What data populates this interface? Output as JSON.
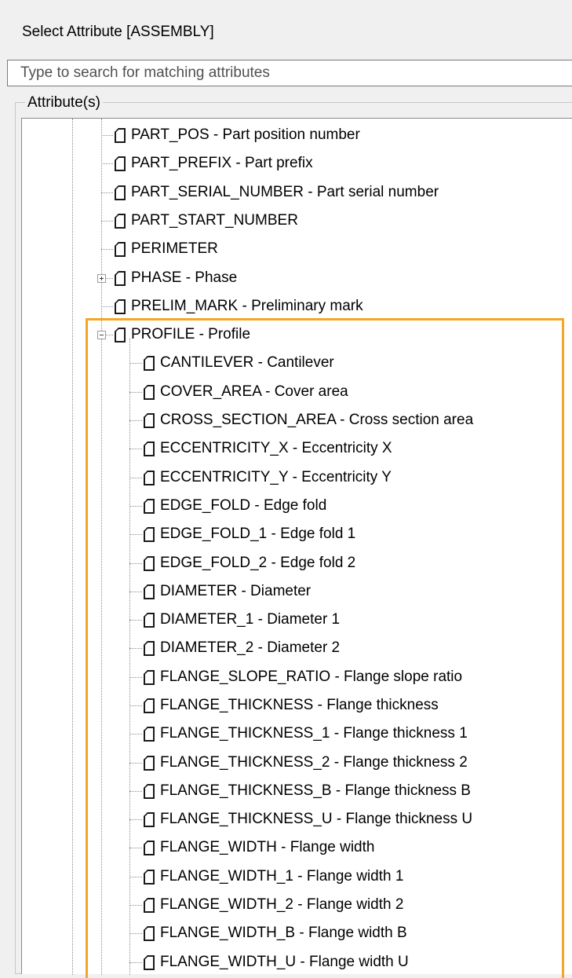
{
  "dialog": {
    "title": "Select Attribute [ASSEMBLY]"
  },
  "search": {
    "placeholder": "Type to search for matching attributes",
    "value": ""
  },
  "attributes_group": {
    "label": "Attribute(s)"
  },
  "colors": {
    "highlight": "#f5a623"
  },
  "tree": {
    "items": [
      {
        "name": "PART_POS",
        "description": "Part position number",
        "text": "PART_POS  -  Part position number",
        "level": 1
      },
      {
        "name": "PART_PREFIX",
        "description": "Part prefix",
        "text": "PART_PREFIX  -  Part prefix",
        "level": 1
      },
      {
        "name": "PART_SERIAL_NUMBER",
        "description": "Part serial number",
        "text": "PART_SERIAL_NUMBER  -  Part serial number",
        "level": 1
      },
      {
        "name": "PART_START_NUMBER",
        "description": "",
        "text": "PART_START_NUMBER",
        "level": 1
      },
      {
        "name": "PERIMETER",
        "description": "",
        "text": "PERIMETER",
        "level": 1
      },
      {
        "name": "PHASE",
        "description": "Phase",
        "text": "PHASE  -  Phase",
        "level": 1,
        "expander": "collapsed"
      },
      {
        "name": "PRELIM_MARK",
        "description": "Preliminary mark",
        "text": "PRELIM_MARK  -  Preliminary mark",
        "level": 1
      },
      {
        "name": "PROFILE",
        "description": "Profile",
        "text": "PROFILE  -  Profile",
        "level": 1,
        "expander": "expanded"
      },
      {
        "name": "CANTILEVER",
        "description": "Cantilever",
        "text": "CANTILEVER  -  Cantilever",
        "level": 2
      },
      {
        "name": "COVER_AREA",
        "description": "Cover area",
        "text": "COVER_AREA  -  Cover area",
        "level": 2
      },
      {
        "name": "CROSS_SECTION_AREA",
        "description": "Cross section area",
        "text": "CROSS_SECTION_AREA  -  Cross section area",
        "level": 2
      },
      {
        "name": "ECCENTRICITY_X",
        "description": "Eccentricity X",
        "text": "ECCENTRICITY_X  -  Eccentricity X",
        "level": 2
      },
      {
        "name": "ECCENTRICITY_Y",
        "description": "Eccentricity Y",
        "text": "ECCENTRICITY_Y  -  Eccentricity Y",
        "level": 2
      },
      {
        "name": "EDGE_FOLD",
        "description": "Edge fold",
        "text": "EDGE_FOLD  -  Edge fold",
        "level": 2
      },
      {
        "name": "EDGE_FOLD_1",
        "description": "Edge fold 1",
        "text": "EDGE_FOLD_1  -  Edge fold 1",
        "level": 2
      },
      {
        "name": "EDGE_FOLD_2",
        "description": "Edge fold 2",
        "text": "EDGE_FOLD_2  -  Edge fold 2",
        "level": 2
      },
      {
        "name": "DIAMETER",
        "description": "Diameter",
        "text": "DIAMETER  -  Diameter",
        "level": 2
      },
      {
        "name": "DIAMETER_1",
        "description": "Diameter 1",
        "text": "DIAMETER_1  -  Diameter 1",
        "level": 2
      },
      {
        "name": "DIAMETER_2",
        "description": "Diameter 2",
        "text": "DIAMETER_2  -  Diameter 2",
        "level": 2
      },
      {
        "name": "FLANGE_SLOPE_RATIO",
        "description": "Flange slope ratio",
        "text": "FLANGE_SLOPE_RATIO  -  Flange slope ratio",
        "level": 2
      },
      {
        "name": "FLANGE_THICKNESS",
        "description": "Flange thickness",
        "text": "FLANGE_THICKNESS  -  Flange thickness",
        "level": 2
      },
      {
        "name": "FLANGE_THICKNESS_1",
        "description": "Flange thickness 1",
        "text": "FLANGE_THICKNESS_1  -  Flange thickness 1",
        "level": 2
      },
      {
        "name": "FLANGE_THICKNESS_2",
        "description": "Flange thickness 2",
        "text": "FLANGE_THICKNESS_2  -  Flange thickness 2",
        "level": 2
      },
      {
        "name": "FLANGE_THICKNESS_B",
        "description": "Flange thickness B",
        "text": "FLANGE_THICKNESS_B  -  Flange thickness B",
        "level": 2
      },
      {
        "name": "FLANGE_THICKNESS_U",
        "description": "Flange thickness U",
        "text": "FLANGE_THICKNESS_U  -  Flange thickness U",
        "level": 2
      },
      {
        "name": "FLANGE_WIDTH",
        "description": "Flange width",
        "text": "FLANGE_WIDTH  -  Flange width",
        "level": 2
      },
      {
        "name": "FLANGE_WIDTH_1",
        "description": "Flange width 1",
        "text": "FLANGE_WIDTH_1  -  Flange width 1",
        "level": 2
      },
      {
        "name": "FLANGE_WIDTH_2",
        "description": "Flange width 2",
        "text": "FLANGE_WIDTH_2  -  Flange width 2",
        "level": 2
      },
      {
        "name": "FLANGE_WIDTH_B",
        "description": "Flange width B",
        "text": "FLANGE_WIDTH_B  -  Flange width B",
        "level": 2
      },
      {
        "name": "FLANGE_WIDTH_U",
        "description": "Flange width U",
        "text": "FLANGE_WIDTH_U  -  Flange width U",
        "level": 2
      }
    ]
  }
}
